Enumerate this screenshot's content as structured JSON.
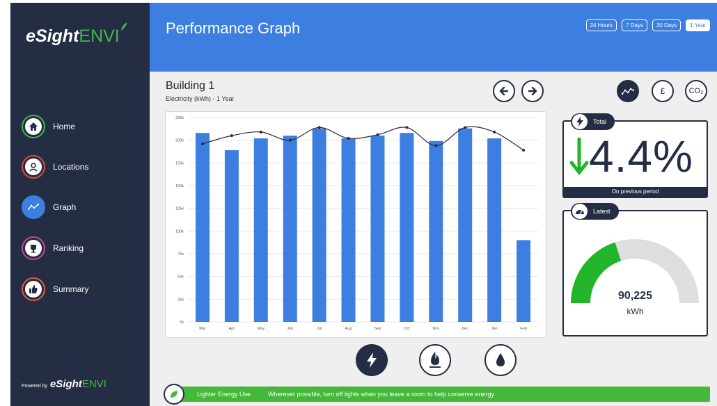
{
  "app": {
    "logo_bold": "eSight",
    "logo_light": "ENVI",
    "powered_by": "Powered by"
  },
  "sidebar": {
    "items": [
      {
        "label": "Home",
        "icon": "home-icon",
        "color": "#3db54a"
      },
      {
        "label": "Locations",
        "icon": "locations-icon",
        "color": "#e0483e"
      },
      {
        "label": "Graph",
        "icon": "graph-icon",
        "color": "#3d7fe0",
        "active": true
      },
      {
        "label": "Ranking",
        "icon": "trophy-icon",
        "color": "#c54a8c"
      },
      {
        "label": "Summary",
        "icon": "thumbs-up-icon",
        "color": "#e65a3a"
      }
    ]
  },
  "header": {
    "title": "Performance Graph",
    "ranges": [
      "24 Hours",
      "7 Days",
      "30 Days",
      "1 Year"
    ],
    "active_range": "1 Year"
  },
  "building": {
    "name": "Building 1",
    "subtitle": "Electricity (kWh) - 1 Year"
  },
  "controls": {
    "unit_gbp": "£",
    "unit_co2": "CO₂"
  },
  "total_card": {
    "label": "Total",
    "value": "4.4%",
    "direction": "down",
    "footer": "On previous period"
  },
  "latest_card": {
    "label": "Latest",
    "value": "90,225",
    "unit": "kWh",
    "gauge_fraction": 0.4,
    "gauge_color": "#22b52a"
  },
  "tip": {
    "title": "Lighter Energy Use",
    "text": "Wherever possible, turn off lights when you leave a room to help conserve energy"
  },
  "colors": {
    "sidebar": "#252d44",
    "accent": "#3d7fe0",
    "green": "#44b83a",
    "bar": "#3d7fe0"
  },
  "chart_data": {
    "type": "bar",
    "categories": [
      "Mar",
      "Apr",
      "May",
      "Jun",
      "Jul",
      "Aug",
      "Sep",
      "Oct",
      "Nov",
      "Dec",
      "Jan",
      "Feb"
    ],
    "series": [
      {
        "type": "bar",
        "values": [
          208000,
          189000,
          202000,
          205000,
          213000,
          202000,
          205000,
          208000,
          199000,
          213000,
          202000,
          90000
        ]
      },
      {
        "type": "line",
        "values": [
          196000,
          205000,
          209000,
          200000,
          214000,
          202000,
          206000,
          214000,
          194000,
          214000,
          209000,
          189000
        ]
      }
    ],
    "yticks": [
      "0k",
      "25k",
      "50k",
      "75k",
      "100k",
      "125k",
      "150k",
      "175k",
      "200k",
      "225k"
    ],
    "ylim": [
      0,
      225000
    ],
    "grid": true
  }
}
